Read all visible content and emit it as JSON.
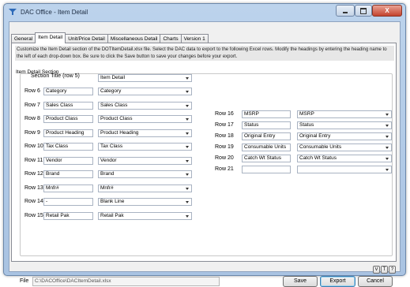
{
  "window": {
    "title": "DAC Office - Item Detail",
    "close_glyph": "X"
  },
  "tabs": [
    {
      "label": "General",
      "active": false
    },
    {
      "label": "Item Detail",
      "active": true
    },
    {
      "label": "Unit/Price Detail",
      "active": false
    },
    {
      "label": "Miscellaneous Detail",
      "active": false
    },
    {
      "label": "Charts",
      "active": false
    },
    {
      "label": "Version 1",
      "active": false
    }
  ],
  "instructions": "Customize the Item Detail section of the DOTItemDetail.xlsx file.  Select the DAC data to export to the following Excel rows.  Modify the headings by entering the heading name to the left of each drop-down box.  Be sure to click the Save button to save your changes before your export.",
  "section": {
    "label": "Item Detail Section",
    "title_label": "Section Title (row 5)",
    "title_value": "Item Detail"
  },
  "left_rows": [
    {
      "row": "Row 6",
      "heading": "Category",
      "field": "Category"
    },
    {
      "row": "Row 7",
      "heading": "Sales Class",
      "field": "Sales Class"
    },
    {
      "row": "Row 8",
      "heading": "Product Class",
      "field": "Product Class"
    },
    {
      "row": "Row 9",
      "heading": "Product Heading",
      "field": "Product Heading"
    },
    {
      "row": "Row 10",
      "heading": "Tax Class",
      "field": "Tax Class"
    },
    {
      "row": "Row 11",
      "heading": "Vendor",
      "field": "Vendor"
    },
    {
      "row": "Row 12",
      "heading": "Brand",
      "field": "Brand"
    },
    {
      "row": "Row 13",
      "heading": "Mnfr#",
      "field": "Mnfr#"
    },
    {
      "row": "Row 14",
      "heading": "-",
      "field": "Blank Line"
    },
    {
      "row": "Row 15",
      "heading": "Retail Pak",
      "field": "Retail Pak"
    }
  ],
  "right_rows": [
    {
      "row": "Row 16",
      "heading": "MSRP",
      "field": "MSRP"
    },
    {
      "row": "Row 17",
      "heading": "Status",
      "field": "Status"
    },
    {
      "row": "Row 18",
      "heading": "Original Entry",
      "field": "Original Entry"
    },
    {
      "row": "Row 19",
      "heading": "Consumable Units",
      "field": "Consumable Units"
    },
    {
      "row": "Row 20",
      "heading": "Catch Wt Status",
      "field": "Catch Wt Status"
    },
    {
      "row": "Row 21",
      "heading": "",
      "field": ""
    }
  ],
  "help_buttons": [
    "V",
    "T",
    "?"
  ],
  "footer": {
    "file_label": "File",
    "file_path": "C:\\DACOffice\\DACItemDetail.xlsx",
    "save": "Save",
    "export": "Export",
    "cancel": "Cancel"
  },
  "colors": {
    "frame": "#bcd3ec",
    "close": "#c4432e",
    "panel": "#ffffff"
  }
}
